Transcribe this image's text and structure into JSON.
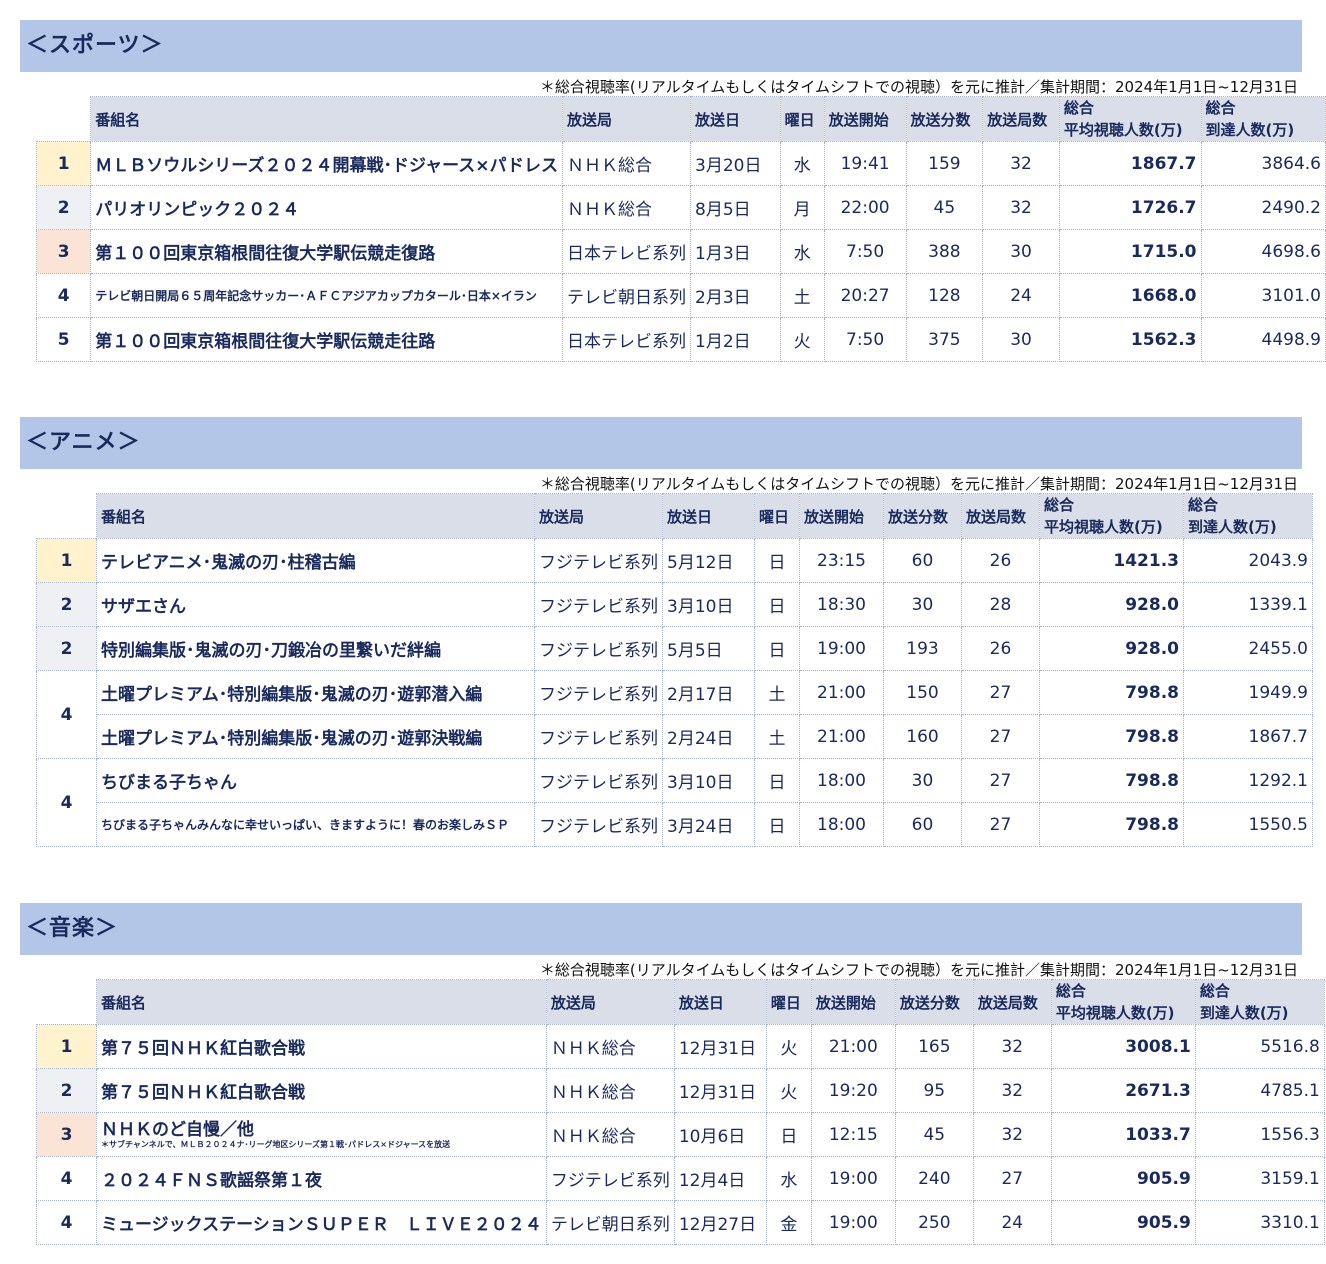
{
  "note": "＊総合視聴率(リアルタイムもしくはタイムシフトでの視聴）を元に推計／集計期間：2024年1月1日~12月31日",
  "headers": {
    "program": "番組名",
    "station": "放送局",
    "date": "放送日",
    "weekday": "曜日",
    "start": "放送開始",
    "minutes": "放送分数",
    "stations_count": "放送局数",
    "avg_top": "総合",
    "avg_bottom": "平均視聴人数(万)",
    "reach_top": "総合",
    "reach_bottom": "到達人数(万)"
  },
  "sections": [
    {
      "title": "＜スポーツ＞",
      "rows": [
        {
          "rank": "1",
          "program": "ＭＬＢソウルシリーズ２０２４開幕戦･ドジャース×パドレス",
          "station": "ＮＨＫ総合",
          "date": "3月20日",
          "weekday": "水",
          "start": "19:41",
          "minutes": "159",
          "stations_count": "32",
          "avg": "1867.7",
          "reach": "3864.6"
        },
        {
          "rank": "2",
          "program": "パリオリンピック２０２４",
          "station": "ＮＨＫ総合",
          "date": "8月5日",
          "weekday": "月",
          "start": "22:00",
          "minutes": "45",
          "stations_count": "32",
          "avg": "1726.7",
          "reach": "2490.2"
        },
        {
          "rank": "3",
          "program": "第１００回東京箱根間往復大学駅伝競走復路",
          "station": "日本テレビ系列",
          "date": "1月3日",
          "weekday": "水",
          "start": "7:50",
          "minutes": "388",
          "stations_count": "30",
          "avg": "1715.0",
          "reach": "4698.6"
        },
        {
          "rank": "4",
          "program": "テレビ朝日開局６５周年記念サッカー･ＡＦＣアジアカップカタール･日本×イラン",
          "station": "テレビ朝日系列",
          "date": "2月3日",
          "weekday": "土",
          "start": "20:27",
          "minutes": "128",
          "stations_count": "24",
          "avg": "1668.0",
          "reach": "3101.0"
        },
        {
          "rank": "5",
          "program": "第１００回東京箱根間往復大学駅伝競走往路",
          "station": "日本テレビ系列",
          "date": "1月2日",
          "weekday": "火",
          "start": "7:50",
          "minutes": "375",
          "stations_count": "30",
          "avg": "1562.3",
          "reach": "4498.9"
        }
      ]
    },
    {
      "title": "＜アニメ＞",
      "rows": [
        {
          "rank": "1",
          "program": "テレビアニメ･鬼滅の刃･柱稽古編",
          "station": "フジテレビ系列",
          "date": "5月12日",
          "weekday": "日",
          "start": "23:15",
          "minutes": "60",
          "stations_count": "26",
          "avg": "1421.3",
          "reach": "2043.9"
        },
        {
          "rank": "2",
          "program": "サザエさん",
          "station": "フジテレビ系列",
          "date": "3月10日",
          "weekday": "日",
          "start": "18:30",
          "minutes": "30",
          "stations_count": "28",
          "avg": "928.0",
          "reach": "1339.1"
        },
        {
          "rank": "2",
          "program": "特別編集版･鬼滅の刃･刀鍛冶の里繋いだ絆編",
          "station": "フジテレビ系列",
          "date": "5月5日",
          "weekday": "日",
          "start": "19:00",
          "minutes": "193",
          "stations_count": "26",
          "avg": "928.0",
          "reach": "2455.0"
        },
        {
          "rank": "4",
          "program": "土曜プレミアム･特別編集版･鬼滅の刃･遊郭潜入編",
          "station": "フジテレビ系列",
          "date": "2月17日",
          "weekday": "土",
          "start": "21:00",
          "minutes": "150",
          "stations_count": "27",
          "avg": "798.8",
          "reach": "1949.9"
        },
        {
          "rank": "",
          "program": "土曜プレミアム･特別編集版･鬼滅の刃･遊郭決戦編",
          "station": "フジテレビ系列",
          "date": "2月24日",
          "weekday": "土",
          "start": "21:00",
          "minutes": "160",
          "stations_count": "27",
          "avg": "798.8",
          "reach": "1867.7"
        },
        {
          "rank": "4",
          "program": "ちびまる子ちゃん",
          "station": "フジテレビ系列",
          "date": "3月10日",
          "weekday": "日",
          "start": "18:00",
          "minutes": "30",
          "stations_count": "27",
          "avg": "798.8",
          "reach": "1292.1"
        },
        {
          "rank": "",
          "program": "ちびまる子ちゃんみんなに幸せいっぱい、きますように！春のお楽しみＳＰ",
          "station": "フジテレビ系列",
          "date": "3月24日",
          "weekday": "日",
          "start": "18:00",
          "minutes": "60",
          "stations_count": "27",
          "avg": "798.8",
          "reach": "1550.5"
        }
      ]
    },
    {
      "title": "＜音楽＞",
      "rows": [
        {
          "rank": "1",
          "program": "第７５回ＮＨＫ紅白歌合戦",
          "station": "ＮＨＫ総合",
          "date": "12月31日",
          "weekday": "火",
          "start": "21:00",
          "minutes": "165",
          "stations_count": "32",
          "avg": "3008.1",
          "reach": "5516.8"
        },
        {
          "rank": "2",
          "program": "第７５回ＮＨＫ紅白歌合戦",
          "station": "ＮＨＫ総合",
          "date": "12月31日",
          "weekday": "火",
          "start": "19:20",
          "minutes": "95",
          "stations_count": "32",
          "avg": "2671.3",
          "reach": "4785.1"
        },
        {
          "rank": "3",
          "program": "ＮＨＫのど自慢／他",
          "sub": "＊サブチャンネルで、ＭＬＢ２０２４ナ･リーグ地区シリーズ第１戦･パドレス×ドジャースを放送",
          "station": "ＮＨＫ総合",
          "date": "10月6日",
          "weekday": "日",
          "start": "12:15",
          "minutes": "45",
          "stations_count": "32",
          "avg": "1033.7",
          "reach": "1556.3"
        },
        {
          "rank": "4",
          "program": "２０２４ＦＮＳ歌謡祭第１夜",
          "station": "フジテレビ系列",
          "date": "12月4日",
          "weekday": "水",
          "start": "19:00",
          "minutes": "240",
          "stations_count": "27",
          "avg": "905.9",
          "reach": "3159.1"
        },
        {
          "rank": "4",
          "program": "ミュージックステーションＳＵＰＥＲ　ＬＩＶＥ２０２４",
          "station": "テレビ朝日系列",
          "date": "12月27日",
          "weekday": "金",
          "start": "19:00",
          "minutes": "250",
          "stations_count": "24",
          "avg": "905.9",
          "reach": "3310.1"
        }
      ]
    }
  ]
}
